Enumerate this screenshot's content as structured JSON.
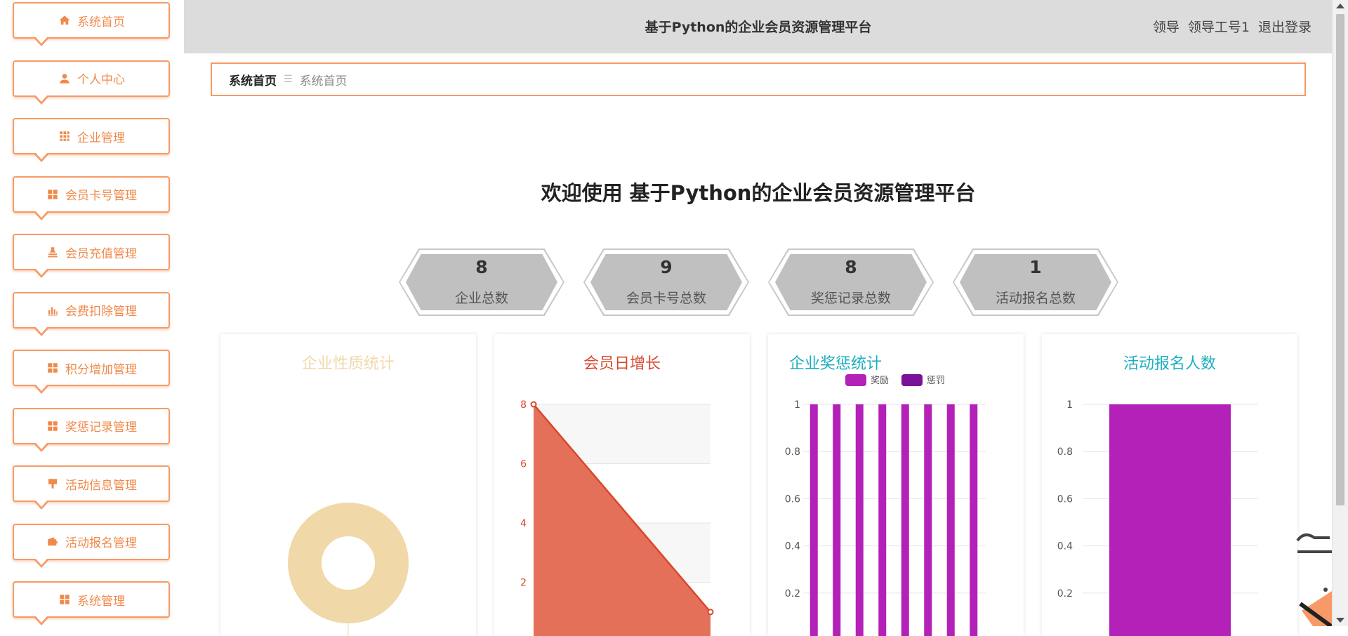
{
  "sidebar": {
    "items": [
      {
        "label": "系统首页",
        "icon": "home-icon"
      },
      {
        "label": "个人中心",
        "icon": "user-icon"
      },
      {
        "label": "企业管理",
        "icon": "grid-icon"
      },
      {
        "label": "会员卡号管理",
        "icon": "apps-icon"
      },
      {
        "label": "会员充值管理",
        "icon": "stamp-icon"
      },
      {
        "label": "会费扣除管理",
        "icon": "bar-chart-icon"
      },
      {
        "label": "积分增加管理",
        "icon": "apps-icon"
      },
      {
        "label": "奖惩记录管理",
        "icon": "apps-icon"
      },
      {
        "label": "活动信息管理",
        "icon": "brush-icon"
      },
      {
        "label": "活动报名管理",
        "icon": "wallet-icon"
      },
      {
        "label": "系统管理",
        "icon": "apps-icon"
      }
    ]
  },
  "header": {
    "title": "基于Python的企业会员资源管理平台",
    "role": "领导",
    "user": "领导工号1",
    "logout": "退出登录"
  },
  "breadcrumb": {
    "home": "系统首页",
    "current": "系统首页"
  },
  "welcome": "欢迎使用 基于Python的企业会员资源管理平台",
  "stats": [
    {
      "value": "8",
      "label": "企业总数"
    },
    {
      "value": "9",
      "label": "会员卡号总数"
    },
    {
      "value": "8",
      "label": "奖惩记录总数"
    },
    {
      "value": "1",
      "label": "活动报名总数"
    }
  ],
  "colors": {
    "accent": "#f79a67",
    "donut": "#f0d8a8",
    "line": "#d9472b",
    "area": "#e5705a",
    "reward": "#b321b9",
    "punish": "#7b1196",
    "teal": "#1aaec0"
  },
  "chart_data": [
    {
      "type": "pie",
      "title": "企业性质统计",
      "slices": [
        {
          "name": "",
          "value": 8
        }
      ]
    },
    {
      "type": "area",
      "title": "会员日增长",
      "x": [
        "",
        ""
      ],
      "values": [
        8,
        1
      ],
      "yticks": [
        "2",
        "4",
        "6",
        "8"
      ],
      "ylim": [
        0,
        8
      ]
    },
    {
      "type": "bar",
      "title": "企业奖惩统计",
      "legend": [
        "奖励",
        "惩罚"
      ],
      "series": [
        {
          "name": "奖励",
          "values": [
            1,
            1,
            1,
            1,
            1,
            1,
            1,
            1
          ]
        },
        {
          "name": "惩罚",
          "values": [
            0,
            0,
            0,
            0,
            0,
            0,
            0,
            0
          ]
        }
      ],
      "yticks": [
        "0.2",
        "0.4",
        "0.6",
        "0.8",
        "1"
      ],
      "ylim": [
        0,
        1
      ]
    },
    {
      "type": "bar",
      "title": "活动报名人数",
      "values": [
        1
      ],
      "yticks": [
        "0.2",
        "0.4",
        "0.6",
        "0.8",
        "1"
      ],
      "ylim": [
        0,
        1
      ]
    }
  ]
}
